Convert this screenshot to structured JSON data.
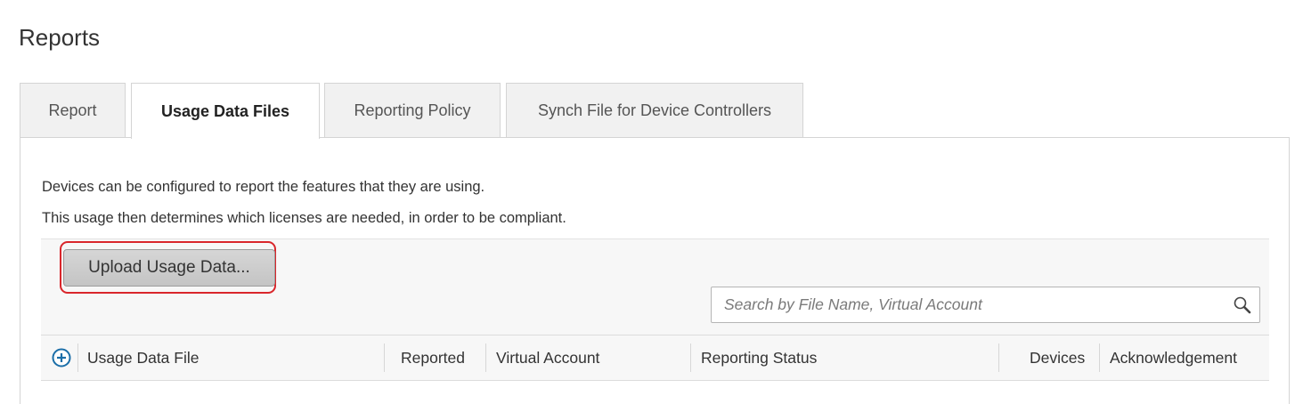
{
  "page": {
    "title": "Reports"
  },
  "tabs": [
    {
      "label": "Report",
      "active": false
    },
    {
      "label": "Usage Data Files",
      "active": true
    },
    {
      "label": "Reporting Policy",
      "active": false
    },
    {
      "label": "Synch File for Device Controllers",
      "active": false
    }
  ],
  "description": {
    "line1": "Devices can be configured to report the features that they are using.",
    "line2": "This usage then determines which licenses are needed, in order to be compliant."
  },
  "toolbar": {
    "upload_label": "Upload Usage Data...",
    "highlight_color": "#d9262b"
  },
  "search": {
    "placeholder": "Search by File Name, Virtual Account",
    "value": "",
    "icon": "search-icon"
  },
  "table": {
    "add_icon": "plus-circle-icon",
    "columns": [
      "Usage Data File",
      "Reported",
      "Virtual Account",
      "Reporting Status",
      "Devices",
      "Acknowledgement"
    ]
  },
  "colors": {
    "accent": "#1b6ea8",
    "tab_background": "#f1f1f1",
    "toolbar_background": "#f7f7f7"
  }
}
